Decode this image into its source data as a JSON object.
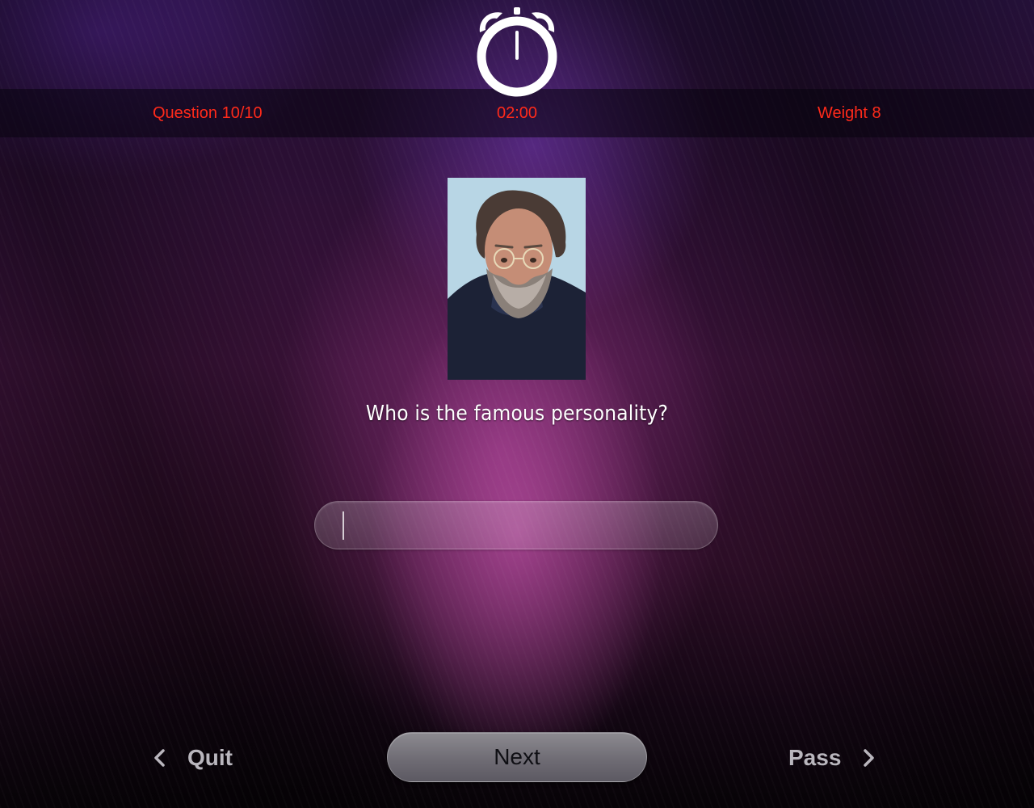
{
  "header": {
    "question_progress": "Question 10/10",
    "timer": "02:00",
    "weight": "Weight 8",
    "timer_icon": "alarm-clock-icon",
    "accent_color": "#ff2a1a"
  },
  "question": {
    "image_name": "famous-personality-portrait",
    "text": "Who is the famous personality?"
  },
  "answer": {
    "value": "",
    "placeholder": ""
  },
  "footer": {
    "quit_label": "Quit",
    "next_label": "Next",
    "pass_label": "Pass",
    "quit_icon": "chevron-left-icon",
    "pass_icon": "chevron-right-icon"
  }
}
